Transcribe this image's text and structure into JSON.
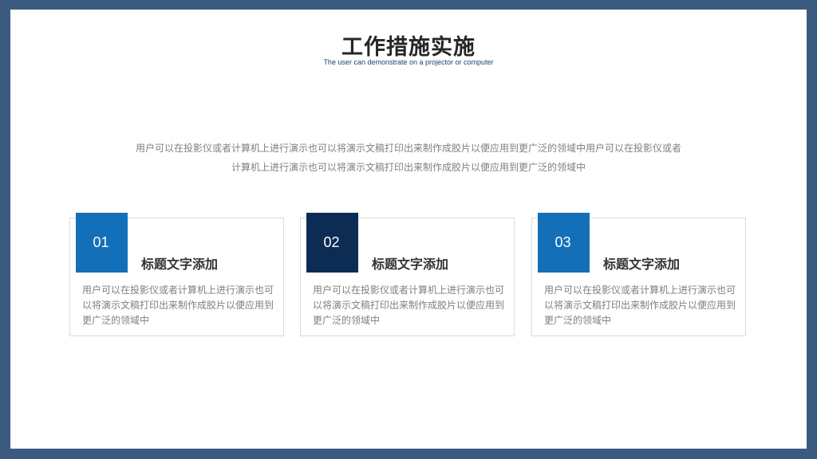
{
  "header": {
    "title": "工作措施实施",
    "subtitle": "The user can demonstrate on a projector or computer"
  },
  "intro": {
    "line1": "用户可以在投影仪或者计算机上进行演示也可以将演示文稿打印出来制作成胶片以便应用到更广泛的领域中用户可以在投影仪或者",
    "line2": "计算机上进行演示也可以将演示文稿打印出来制作成胶片以便应用到更广泛的领域中"
  },
  "cards": [
    {
      "number": "01",
      "title": "标题文字添加",
      "body": "用户可以在投影仪或者计算机上进行演示也可以将演示文稿打印出来制作成胶片以便应用到更广泛的领域中",
      "accent": "#1370b8"
    },
    {
      "number": "02",
      "title": "标题文字添加",
      "body": "用户可以在投影仪或者计算机上进行演示也可以将演示文稿打印出来制作成胶片以便应用到更广泛的领域中",
      "accent": "#0d2c54"
    },
    {
      "number": "03",
      "title": "标题文字添加",
      "body": "用户可以在投影仪或者计算机上进行演示也可以将演示文稿打印出来制作成胶片以便应用到更广泛的领域中",
      "accent": "#1370b8"
    }
  ],
  "colors": {
    "frame": "#3b5a80",
    "primary_blue": "#1370b8",
    "dark_navy": "#0d2c54"
  }
}
